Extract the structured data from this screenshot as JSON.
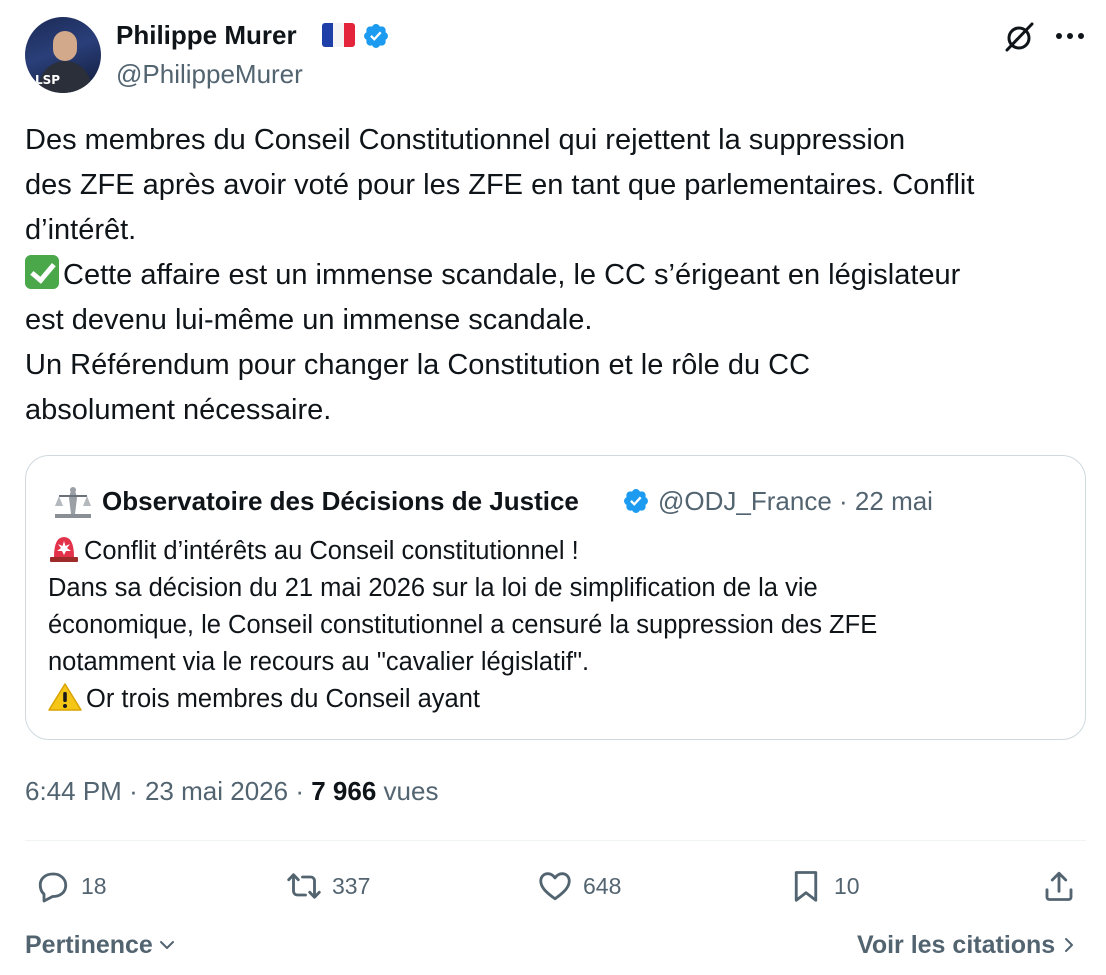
{
  "author": {
    "name": "Philippe Murer",
    "handle": "@PhilippeMurer",
    "avatar_label": "LSP"
  },
  "tweet": {
    "line1": "Des membres du Conseil Constitutionnel qui rejettent la suppression",
    "line2": "des ZFE après avoir voté pour les ZFE en tant que parlementaires. Conflit",
    "line3": "d’intérêt.",
    "line4": "Cette affaire est un immense scandale, le CC s’érigeant en législateur",
    "line5": "est devenu lui-même un immense scandale.",
    "line6": "Un Référendum pour changer la Constitution et le rôle du CC",
    "line7": "absolument nécessaire."
  },
  "quote": {
    "name": "Observatoire des Décisions de Justice",
    "handle": "@ODJ_France",
    "separator": "·",
    "date": "22 mai",
    "line1": "Conflit d’intérêts au Conseil constitutionnel !",
    "line2": "Dans sa décision du 21 mai 2026 sur la loi de simplification de la vie",
    "line3": "économique, le Conseil constitutionnel a censuré la suppression des ZFE",
    "line4": "notamment via le recours au \"cavalier législatif\".",
    "line5": "Or  trois membres du Conseil ayant"
  },
  "meta": {
    "time": "6:44 PM",
    "date": "23 mai 2026",
    "separator": "·",
    "views_count": "7 966",
    "views_label": "vues"
  },
  "actions": {
    "replies": "18",
    "reposts": "337",
    "likes": "648",
    "bookmarks": "10"
  },
  "footer": {
    "sort_label": "Pertinence",
    "quotes_link": "Voir les citations"
  },
  "colors": {
    "verified": "#1d9bf0",
    "text_primary": "#0f1419",
    "text_secondary": "#536471",
    "border": "#cfd9de"
  }
}
